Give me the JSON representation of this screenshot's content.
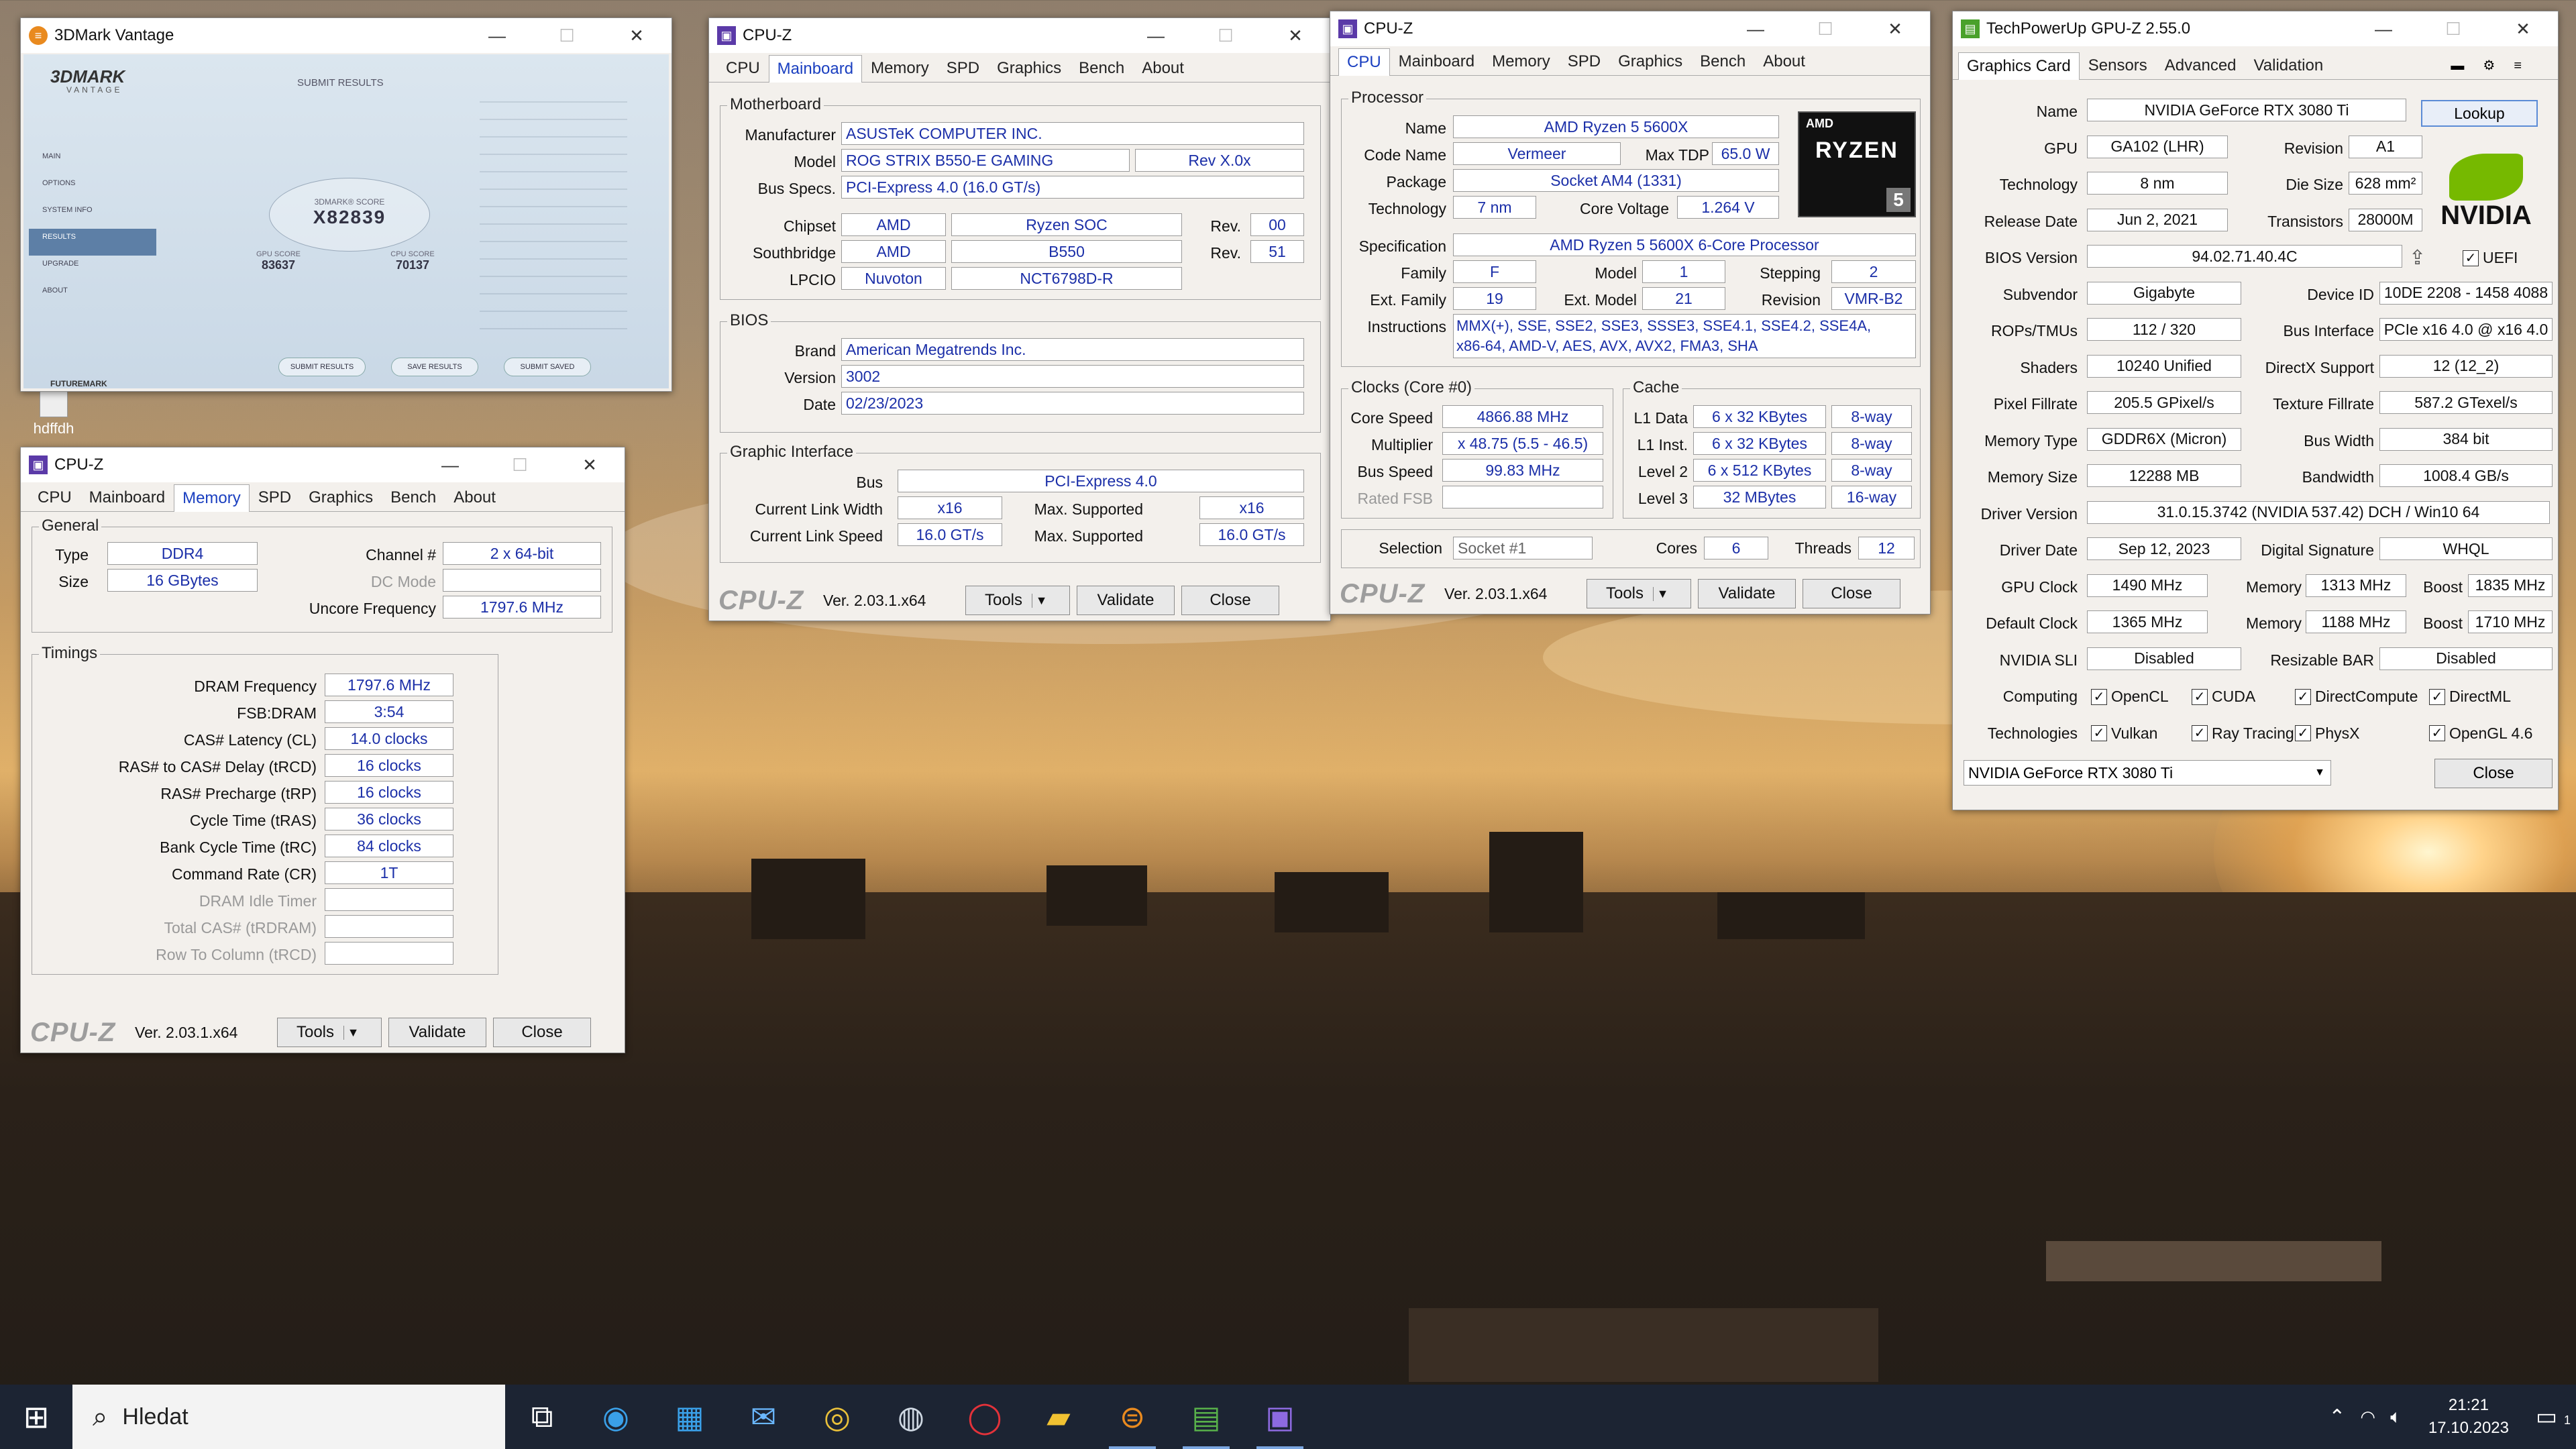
{
  "desktop": {
    "icon_label": "hdffdh"
  },
  "vantage": {
    "title": "3DMark Vantage",
    "logo": "3DMARK",
    "logo_sub": "VANTAGE",
    "header": "SUBMIT RESULTS",
    "menu": [
      "MAIN",
      "OPTIONS",
      "SYSTEM INFO",
      "RESULTS",
      "UPGRADE",
      "ABOUT"
    ],
    "score_label": "3DMARK® SCORE",
    "score": "X82839",
    "gpu_label": "GPU SCORE",
    "gpu": "83637",
    "cpu_label": "CPU SCORE",
    "cpu": "70137",
    "buttons": [
      "SUBMIT RESULTS",
      "SAVE RESULTS",
      "SUBMIT SAVED"
    ],
    "brand": "FUTUREMARK"
  },
  "cpuz_mem": {
    "title": "CPU-Z",
    "tabs": [
      "CPU",
      "Mainboard",
      "Memory",
      "SPD",
      "Graphics",
      "Bench",
      "About"
    ],
    "active": "Memory",
    "general_label": "General",
    "type_label": "Type",
    "type": "DDR4",
    "size_label": "Size",
    "size": "16 GBytes",
    "channel_label": "Channel #",
    "channel": "2 x 64-bit",
    "dc_label": "DC Mode",
    "uncore_label": "Uncore Frequency",
    "uncore": "1797.6 MHz",
    "timings_label": "Timings",
    "timings": [
      {
        "label": "DRAM Frequency",
        "value": "1797.6 MHz"
      },
      {
        "label": "FSB:DRAM",
        "value": "3:54"
      },
      {
        "label": "CAS# Latency (CL)",
        "value": "14.0 clocks"
      },
      {
        "label": "RAS# to CAS# Delay (tRCD)",
        "value": "16 clocks"
      },
      {
        "label": "RAS# Precharge (tRP)",
        "value": "16 clocks"
      },
      {
        "label": "Cycle Time (tRAS)",
        "value": "36 clocks"
      },
      {
        "label": "Bank Cycle Time (tRC)",
        "value": "84 clocks"
      },
      {
        "label": "Command Rate (CR)",
        "value": "1T"
      },
      {
        "label": "DRAM Idle Timer",
        "value": ""
      },
      {
        "label": "Total CAS# (tRDRAM)",
        "value": ""
      },
      {
        "label": "Row To Column (tRCD)",
        "value": ""
      }
    ],
    "footer": {
      "logo": "CPU-Z",
      "version": "Ver. 2.03.1.x64",
      "tools": "Tools",
      "validate": "Validate",
      "close": "Close"
    }
  },
  "cpuz_mb": {
    "title": "CPU-Z",
    "tabs": [
      "CPU",
      "Mainboard",
      "Memory",
      "SPD",
      "Graphics",
      "Bench",
      "About"
    ],
    "active": "Mainboard",
    "motherboard_label": "Motherboard",
    "manufacturer_label": "Manufacturer",
    "manufacturer": "ASUSTeK COMPUTER INC.",
    "model_label": "Model",
    "model": "ROG STRIX B550-E GAMING",
    "rev": "Rev X.0x",
    "busspecs_label": "Bus Specs.",
    "busspecs": "PCI-Express 4.0 (16.0 GT/s)",
    "chipset_label": "Chipset",
    "chipset_vendor": "AMD",
    "chipset": "Ryzen SOC",
    "chipset_rev_label": "Rev.",
    "chipset_rev": "00",
    "south_label": "Southbridge",
    "south_vendor": "AMD",
    "south": "B550",
    "south_rev_label": "Rev.",
    "south_rev": "51",
    "lpcio_label": "LPCIO",
    "lpcio_vendor": "Nuvoton",
    "lpcio": "NCT6798D-R",
    "bios_label": "BIOS",
    "brand_label": "Brand",
    "brand": "American Megatrends Inc.",
    "version_label": "Version",
    "version": "3002",
    "date_label": "Date",
    "date": "02/23/2023",
    "gi_label": "Graphic Interface",
    "bus_label": "Bus",
    "bus": "PCI-Express 4.0",
    "clw_label": "Current Link Width",
    "clw": "x16",
    "msw_label": "Max. Supported",
    "msw": "x16",
    "cls_label": "Current Link Speed",
    "cls": "16.0 GT/s",
    "mss_label": "Max. Supported",
    "mss": "16.0 GT/s",
    "footer": {
      "logo": "CPU-Z",
      "version": "Ver. 2.03.1.x64",
      "tools": "Tools",
      "validate": "Validate",
      "close": "Close"
    }
  },
  "cpuz_cpu": {
    "title": "CPU-Z",
    "tabs": [
      "CPU",
      "Mainboard",
      "Memory",
      "SPD",
      "Graphics",
      "Bench",
      "About"
    ],
    "active": "CPU",
    "processor_label": "Processor",
    "name_label": "Name",
    "name": "AMD Ryzen 5 5600X",
    "code_label": "Code Name",
    "code": "Vermeer",
    "tdp_label": "Max TDP",
    "tdp": "65.0 W",
    "package_label": "Package",
    "package": "Socket AM4 (1331)",
    "tech_label": "Technology",
    "tech": "7 nm",
    "cv_label": "Core Voltage",
    "cv": "1.264 V",
    "spec_label": "Specification",
    "spec": "AMD Ryzen 5 5600X 6-Core Processor",
    "family_label": "Family",
    "family": "F",
    "model_label": "Model",
    "model": "1",
    "stepping_label": "Stepping",
    "stepping": "2",
    "extfam_label": "Ext. Family",
    "extfam": "19",
    "extmodel_label": "Ext. Model",
    "extmodel": "21",
    "revision_label": "Revision",
    "revision": "VMR-B2",
    "instr_label": "Instructions",
    "instr1": "MMX(+), SSE, SSE2, SSE3, SSSE3, SSE4.1, SSE4.2, SSE4A,",
    "instr2": "x86-64, AMD-V, AES, AVX, AVX2, FMA3, SHA",
    "clocks_label": "Clocks (Core #0)",
    "cs_label": "Core Speed",
    "cs": "4866.88 MHz",
    "mult_label": "Multiplier",
    "mult": "x 48.75 (5.5 - 46.5)",
    "bs_label": "Bus Speed",
    "bs": "99.83 MHz",
    "fsb_label": "Rated FSB",
    "cache_label": "Cache",
    "l1d_label": "L1 Data",
    "l1d": "6 x 32 KBytes",
    "l1d_way": "8-way",
    "l1i_label": "L1 Inst.",
    "l1i": "6 x 32 KBytes",
    "l1i_way": "8-way",
    "l2_label": "Level 2",
    "l2": "6 x 512 KBytes",
    "l2_way": "8-way",
    "l3_label": "Level 3",
    "l3": "32 MBytes",
    "l3_way": "16-way",
    "sel_label": "Selection",
    "sel": "Socket #1",
    "cores_label": "Cores",
    "cores": "6",
    "threads_label": "Threads",
    "threads": "12",
    "badge_top": "AMD",
    "badge_mid": "RYZEN",
    "badge_num": "5",
    "footer": {
      "logo": "CPU-Z",
      "version": "Ver. 2.03.1.x64",
      "tools": "Tools",
      "validate": "Validate",
      "close": "Close"
    }
  },
  "gpuz": {
    "title": "TechPowerUp GPU-Z 2.55.0",
    "tabs": [
      "Graphics Card",
      "Sensors",
      "Advanced",
      "Validation"
    ],
    "name_label": "Name",
    "name": "NVIDIA GeForce RTX 3080 Ti",
    "lookup": "Lookup",
    "gpu_label": "GPU",
    "gpu": "GA102 (LHR)",
    "rev_label": "Revision",
    "rev": "A1",
    "tech_label": "Technology",
    "tech": "8 nm",
    "die_label": "Die Size",
    "die": "628 mm²",
    "rd_label": "Release Date",
    "rd": "Jun 2, 2021",
    "tr_label": "Transistors",
    "tr": "28000M",
    "bios_label": "BIOS Version",
    "bios": "94.02.71.40.4C",
    "uefi": "UEFI",
    "sub_label": "Subvendor",
    "sub": "Gigabyte",
    "dev_label": "Device ID",
    "dev": "10DE 2208 - 1458 4088",
    "rops_label": "ROPs/TMUs",
    "rops": "112 / 320",
    "bi_label": "Bus Interface",
    "bi": "PCIe x16 4.0 @ x16 4.0",
    "sh_label": "Shaders",
    "sh": "10240 Unified",
    "dx_label": "DirectX Support",
    "dx": "12 (12_2)",
    "pf_label": "Pixel Fillrate",
    "pf": "205.5 GPixel/s",
    "tf_label": "Texture Fillrate",
    "tf": "587.2 GTexel/s",
    "mt_label": "Memory Type",
    "mt": "GDDR6X (Micron)",
    "bw_label": "Bus Width",
    "bw": "384 bit",
    "ms_label": "Memory Size",
    "ms": "12288 MB",
    "band_label": "Bandwidth",
    "band": "1008.4 GB/s",
    "dv_label": "Driver Version",
    "dv": "31.0.15.3742 (NVIDIA 537.42) DCH / Win10 64",
    "dd_label": "Driver Date",
    "dd": "Sep 12, 2023",
    "ds_label": "Digital Signature",
    "ds": "WHQL",
    "gc_label": "GPU Clock",
    "gc": "1490 MHz",
    "gm_label": "Memory",
    "gm": "1313 MHz",
    "gb_label": "Boost",
    "gb": "1835 MHz",
    "dc_label": "Default Clock",
    "dc": "1365 MHz",
    "dm_label": "Memory",
    "dm": "1188 MHz",
    "db_label": "Boost",
    "db": "1710 MHz",
    "sli_label": "NVIDIA SLI",
    "sli": "Disabled",
    "rb_label": "Resizable BAR",
    "rb": "Disabled",
    "comp_label": "Computing",
    "comp": [
      "OpenCL",
      "CUDA",
      "DirectCompute",
      "DirectML"
    ],
    "techs_label": "Technologies",
    "techs": [
      "Vulkan",
      "Ray Tracing",
      "PhysX",
      "OpenGL 4.6"
    ],
    "select": "NVIDIA GeForce RTX 3080 Ti",
    "close": "Close",
    "brand": "NVIDIA"
  },
  "taskbar": {
    "search": "Hledat",
    "time": "21:21",
    "date": "17.10.2023",
    "notif": "1"
  },
  "colors": {
    "cpuz_value": "#1b2fa8",
    "taskbar": "#1c2433",
    "nvidia_green": "#76b900"
  }
}
